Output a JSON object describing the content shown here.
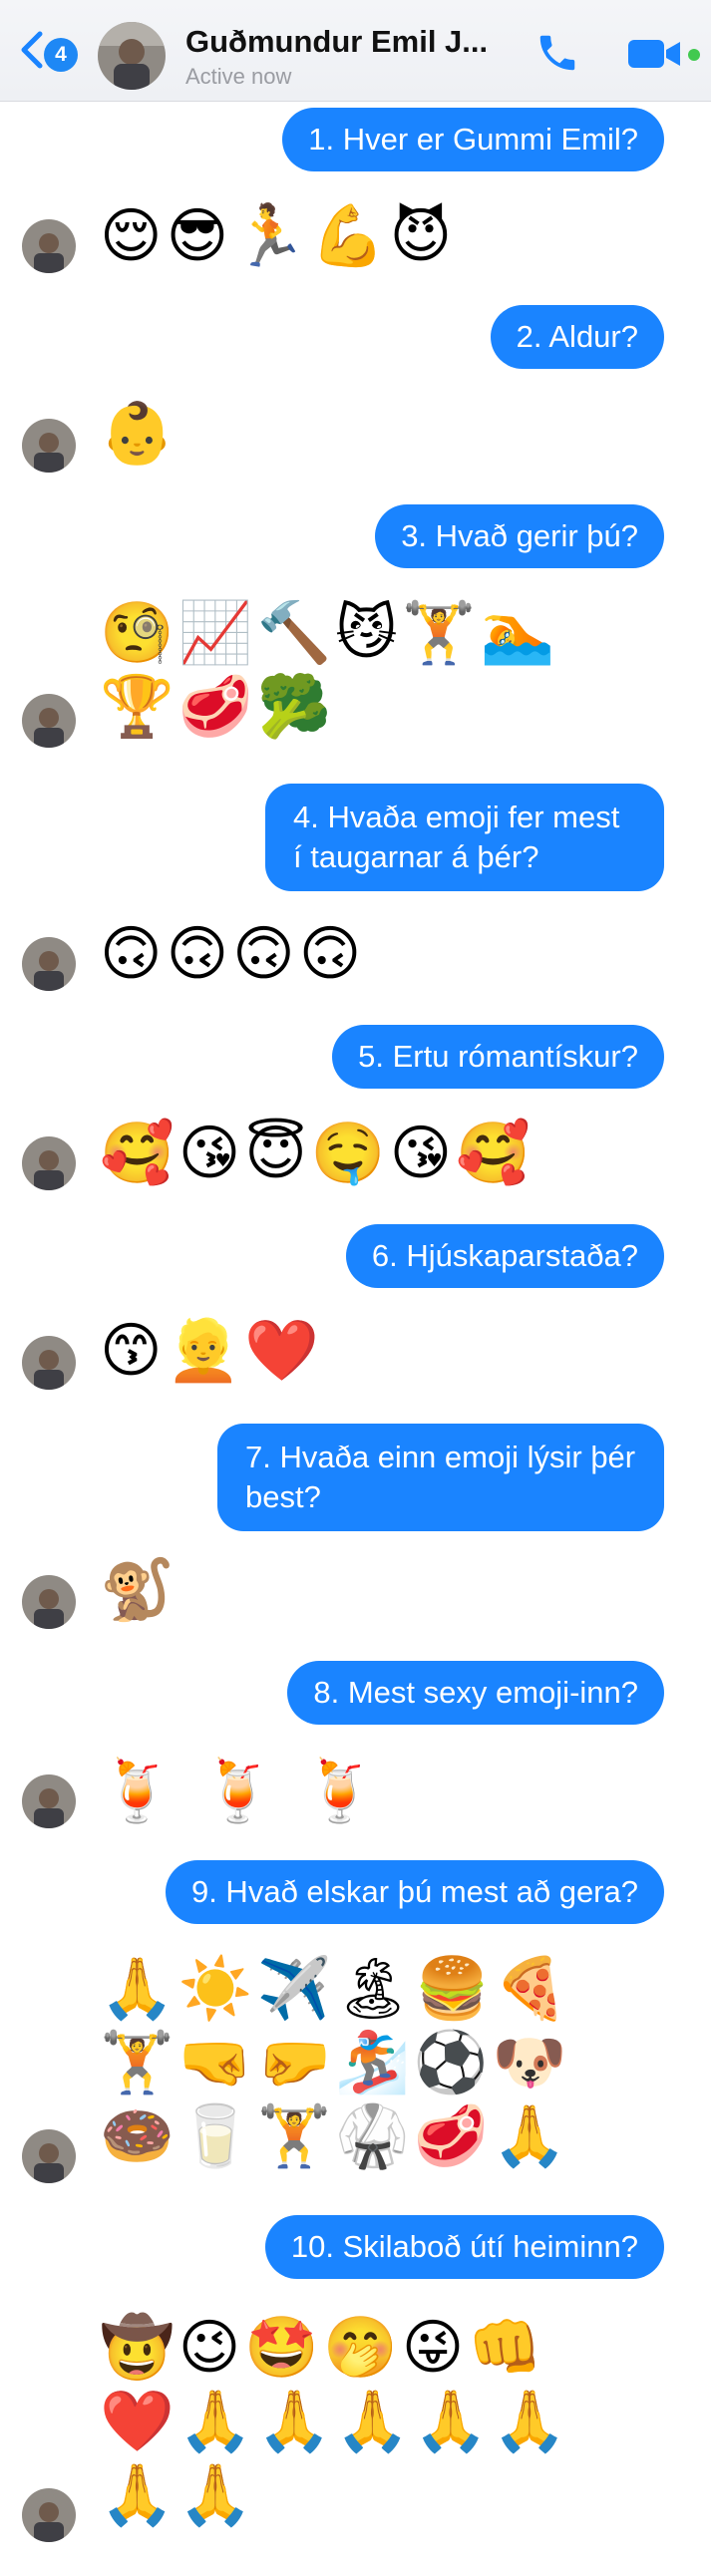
{
  "header": {
    "back_count": "4",
    "contact_name": "Guðmundur Emil J...",
    "status": "Active now",
    "icons": {
      "back": "chevron-left-icon",
      "call": "phone-icon",
      "video": "video-camera-icon"
    },
    "colors": {
      "accent": "#1a84ff",
      "online": "#41c950"
    }
  },
  "messages": [
    {
      "q": "1. Hver er Gummi Emil?",
      "reply": [
        "😌",
        "😎",
        "🏃",
        "💪",
        "😈"
      ]
    },
    {
      "q": "2. Aldur?",
      "reply": [
        "👶"
      ]
    },
    {
      "q": "3. Hvað gerir þú?",
      "reply": [
        "🧐",
        "📈",
        "🔨",
        "😼",
        "🏋",
        "🏊",
        "🏆",
        "🥩",
        "🥦"
      ]
    },
    {
      "q": "4. Hvaða emoji fer mest í taugarnar á þér?",
      "reply": [
        "🙃",
        "🙃",
        "🙃",
        "🙃"
      ]
    },
    {
      "q": "5. Ertu rómantískur?",
      "reply": [
        "🥰",
        "😘",
        "😇",
        "🤤",
        "😘",
        "🥰"
      ]
    },
    {
      "q": "6. Hjúskaparstaða?",
      "reply": [
        "😙",
        "👱",
        "❤️"
      ]
    },
    {
      "q": "7. Hvaða einn emoji lýsir þér best?",
      "reply": [
        "🐒"
      ]
    },
    {
      "q": "8. Mest sexy emoji-inn?",
      "reply": [
        "🍹",
        "🍹",
        "🍹"
      ]
    },
    {
      "q": "9. Hvað elskar þú mest að gera?",
      "reply": [
        "🙏",
        "☀️",
        "✈️",
        "🏝",
        "🍔",
        "🍕",
        "🏋",
        "🤜",
        "🤛",
        "🏂",
        "⚽",
        "🐶",
        "🍩",
        "🥛",
        "🏋",
        "🥋",
        "🥩",
        "🙏"
      ]
    },
    {
      "q": "10. Skilaboð útí heiminn?",
      "reply": [
        "🤠",
        "😉",
        "🤩",
        "🤭",
        "😜",
        "👊",
        "❤️",
        "🙏",
        "🙏",
        "🙏",
        "🙏",
        "🙏",
        "🙏",
        "🙏"
      ]
    }
  ]
}
